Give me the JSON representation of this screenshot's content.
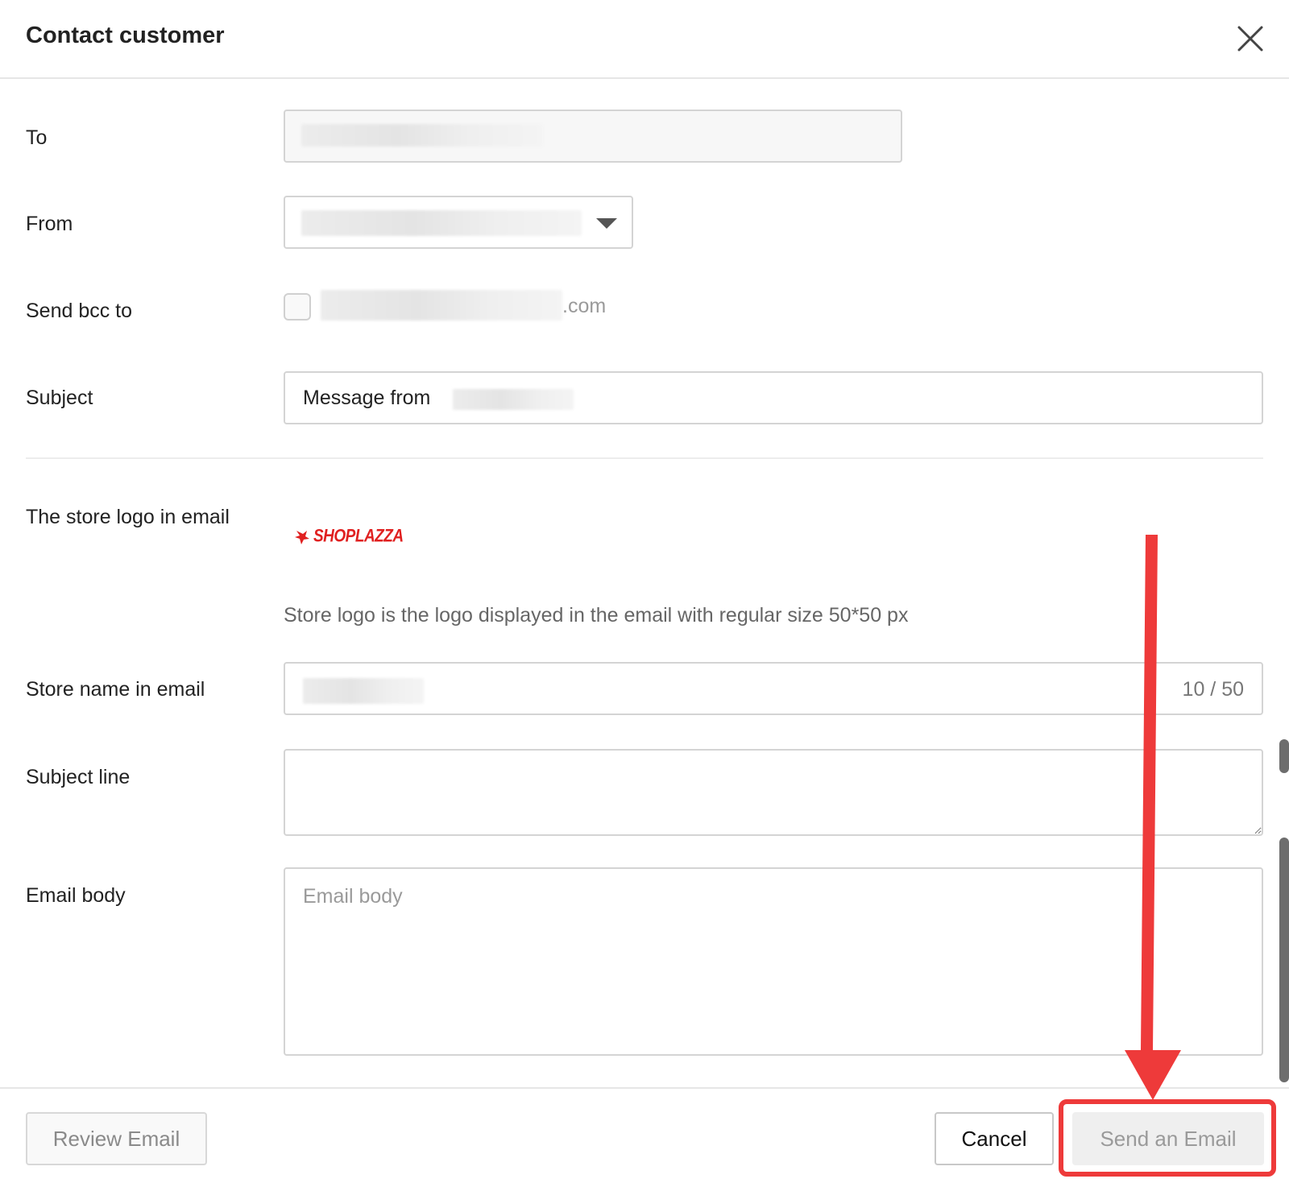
{
  "dialog": {
    "title": "Contact customer"
  },
  "form": {
    "to": {
      "label": "To",
      "value": ""
    },
    "from": {
      "label": "From",
      "value": ""
    },
    "bcc": {
      "label": "Send bcc to",
      "email_suffix": ".com",
      "checked": false
    },
    "subject": {
      "label": "Subject",
      "value_prefix": "Message from"
    },
    "store_logo": {
      "label": "The store logo in email",
      "logo_text": "SHOPLAZZA",
      "hint": "Store logo is the logo displayed in the email with regular size 50*50 px"
    },
    "store_name": {
      "label": "Store name in email",
      "counter": "10 / 50"
    },
    "subject_line": {
      "label": "Subject line",
      "value": ""
    },
    "email_body": {
      "label": "Email body",
      "placeholder": "Email body"
    }
  },
  "footer": {
    "review_label": "Review Email",
    "cancel_label": "Cancel",
    "send_label": "Send an Email"
  },
  "annotation": {
    "color": "#ee3a3a",
    "target": "send-email-button"
  }
}
